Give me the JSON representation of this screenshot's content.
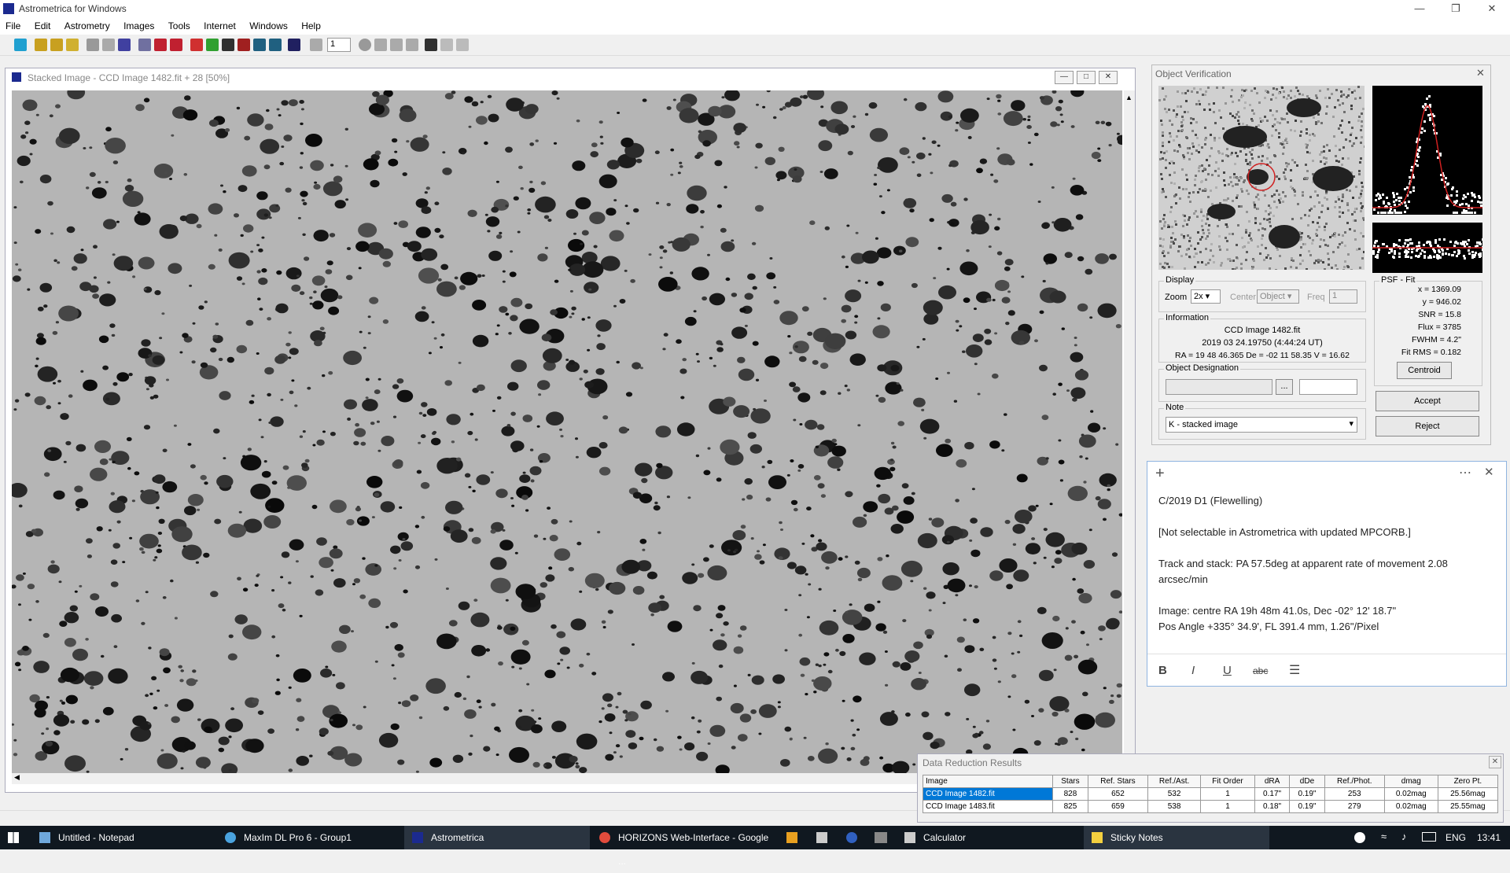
{
  "app": {
    "title": "Astrometrica for Windows",
    "menu": [
      "File",
      "Edit",
      "Astrometry",
      "Images",
      "Tools",
      "Internet",
      "Windows",
      "Help"
    ],
    "toolbar_frame_value": "1"
  },
  "image_window": {
    "title": "Stacked Image - CCD Image 1482.fit + 28 [50%]"
  },
  "object_verification": {
    "title": "Object Verification",
    "display": {
      "label": "Display",
      "zoom_label": "Zoom",
      "zoom_value": "2x",
      "center_label": "Center",
      "center_value": "Object",
      "freq_label": "Freq",
      "freq_value": "1"
    },
    "information": {
      "label": "Information",
      "image": "CCD Image 1482.fit",
      "date": "2019 03 24.19750 (4:44:24 UT)",
      "coords": "RA = 19 48 46.365   De = -02 11 58.35   V = 16.62"
    },
    "designation": {
      "label": "Object Designation",
      "browse": "..."
    },
    "note": {
      "label": "Note",
      "value": "K - stacked image"
    },
    "psf": {
      "label": "PSF - Fit",
      "x": "x = 1369.09",
      "y": "y = 946.02",
      "snr": "SNR = 15.8",
      "flux": "Flux = 3785",
      "fwhm": "FWHM = 4.2\"",
      "fitrms": "Fit RMS = 0.182",
      "centroid": "Centroid"
    },
    "accept": "Accept",
    "reject": "Reject"
  },
  "sticky_note": {
    "lines": [
      "C/2019 D1 (Flewelling)",
      "[Not selectable in Astrometrica with updated MPCORB.]",
      "Track and stack: PA 57.5deg at apparent rate of movement 2.08 arcsec/min",
      "Image: centre RA 19h 48m 41.0s,  Dec -02° 12' 18.7\"",
      "Pos Angle +335° 34.9', FL 391.4 mm, 1.26\"/Pixel"
    ],
    "format": [
      "B",
      "I",
      "U",
      "abc"
    ]
  },
  "data_reduction": {
    "title": "Data Reduction Results",
    "columns": [
      "Image",
      "Stars",
      "Ref. Stars",
      "Ref./Ast.",
      "Fit Order",
      "dRA",
      "dDe",
      "Ref./Phot.",
      "dmag",
      "Zero Pt."
    ],
    "rows": [
      [
        "CCD Image 1482.fit",
        "828",
        "652",
        "532",
        "1",
        "0.17\"",
        "0.19\"",
        "253",
        "0.02mag",
        "25.56mag"
      ],
      [
        "CCD Image 1483.fit",
        "825",
        "659",
        "538",
        "1",
        "0.18\"",
        "0.19\"",
        "279",
        "0.02mag",
        "25.55mag"
      ]
    ]
  },
  "taskbar": {
    "items": [
      {
        "label": "Untitled - Notepad",
        "color": "#6fa8dc"
      },
      {
        "label": "MaxIm DL Pro 6 - Group1",
        "color": "#4aa3df"
      },
      {
        "label": "Astrometrica",
        "color": "#1b2a8f"
      },
      {
        "label": "HORIZONS Web-Interface - Google ...",
        "color": "#e04b3c"
      },
      {
        "label": "Calculator",
        "color": "#cccccc"
      },
      {
        "label": "Sticky Notes",
        "color": "#f4d03f"
      }
    ],
    "lang": "ENG",
    "time": "13:41"
  },
  "colors": {
    "accent": "#0078d7",
    "selected_row": "#0078d7",
    "taskbar": "#101820"
  }
}
